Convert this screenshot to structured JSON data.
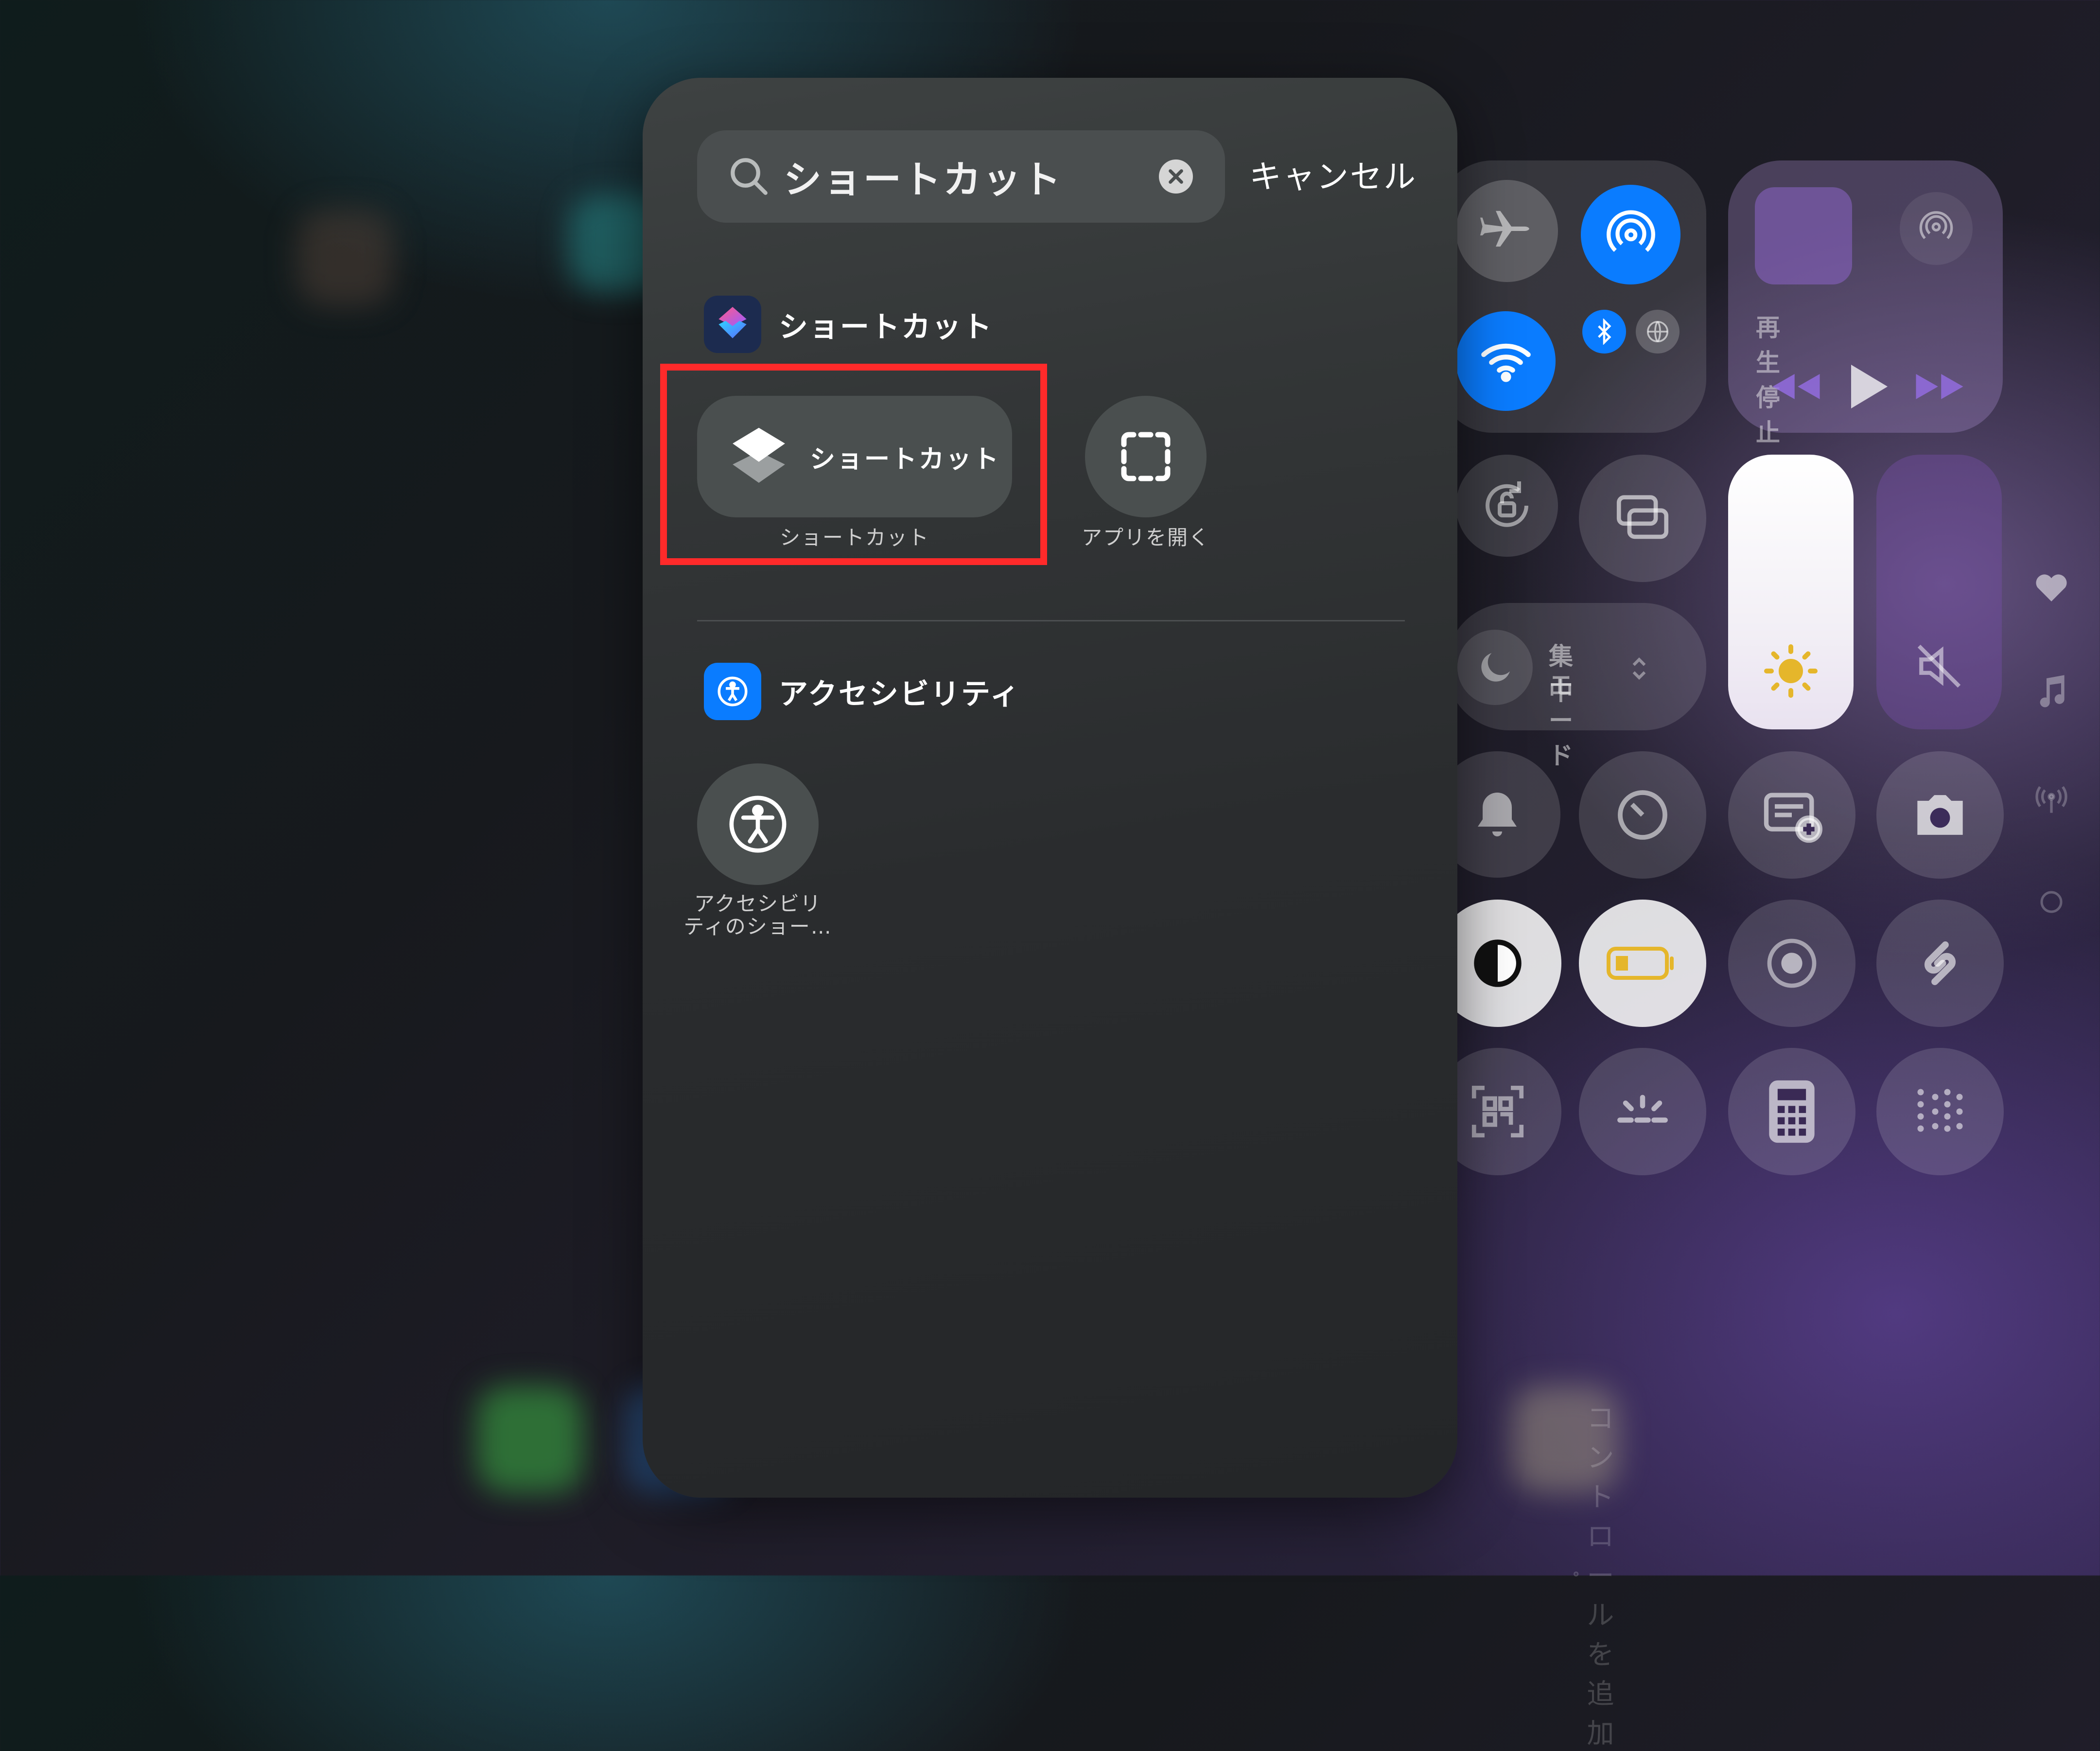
{
  "panel": {
    "search": {
      "query": "ショートカット",
      "clear_icon": "clear-icon"
    },
    "cancel_label": "キャンセル",
    "sections": [
      {
        "title": "ショートカット",
        "icon": "shortcuts-app-icon",
        "actions": [
          {
            "pill_label": "ショートカット",
            "caption": "ショートカット",
            "icon": "shortcuts-layers-icon",
            "highlighted": true
          },
          {
            "caption": "アプリを開く",
            "icon": "dashed-square-icon"
          }
        ]
      },
      {
        "title": "アクセシビリティ",
        "icon": "accessibility-app-icon",
        "actions": [
          {
            "caption_line1": "アクセシビリ",
            "caption_line2": "ティのショー…",
            "icon": "accessibility-icon"
          }
        ]
      }
    ]
  },
  "control_center": {
    "now_playing": "再生停止中",
    "focus_label_line1": "集中",
    "focus_label_line2": "モード",
    "add_control": "コントロールを追加"
  },
  "colors": {
    "accent_blue": "#0a7cff",
    "highlight_red": "#ff2a2a",
    "battery_yellow": "#e5b62b"
  }
}
